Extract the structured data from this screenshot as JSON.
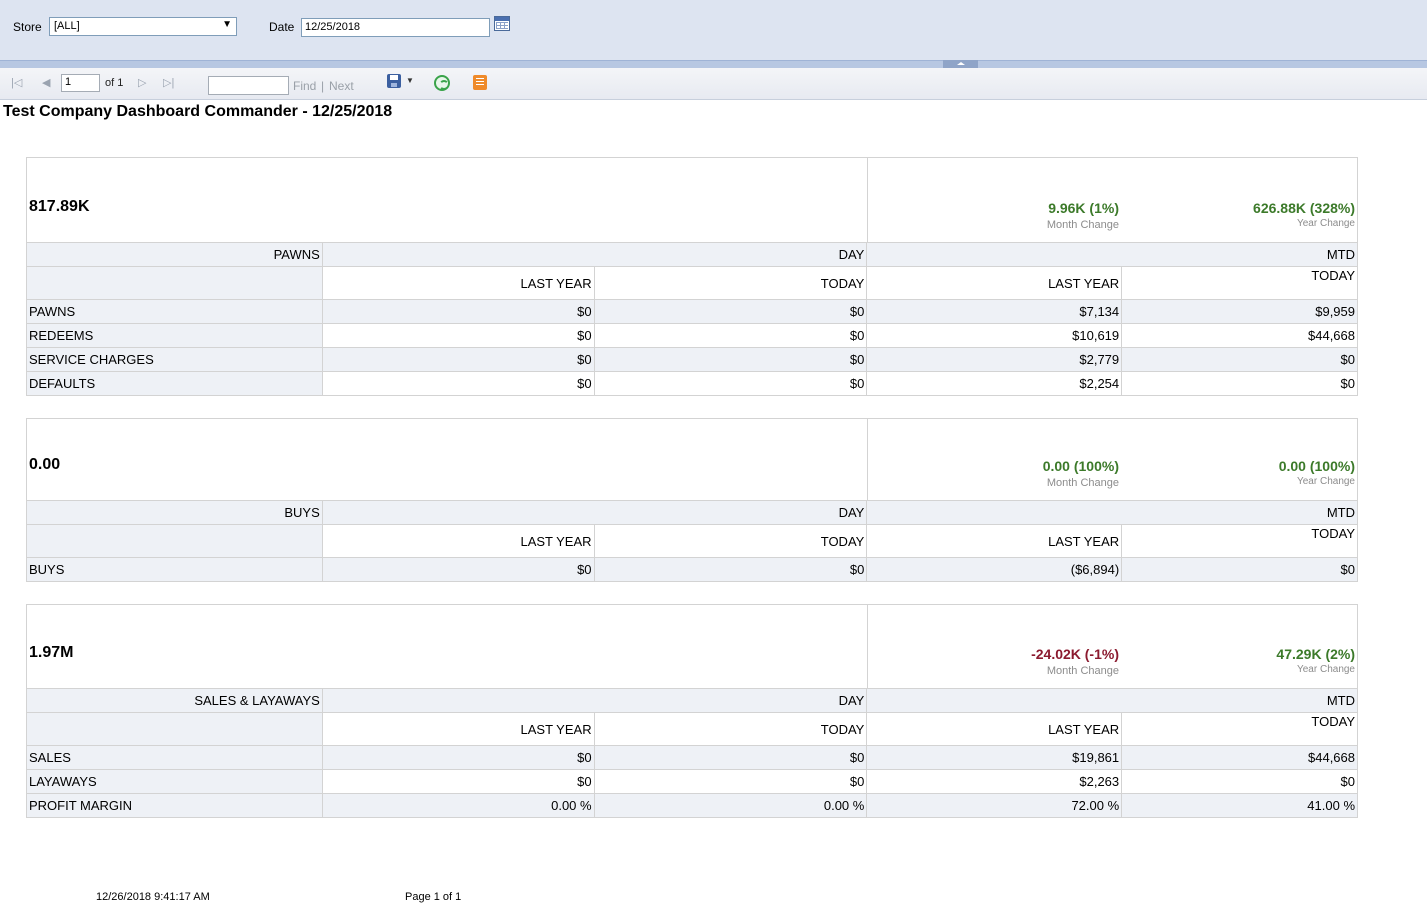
{
  "params": {
    "store_label": "Store",
    "store_value": "[ALL]",
    "date_label": "Date",
    "date_value": "12/25/2018"
  },
  "toolbar": {
    "page_value": "1",
    "of_label": "of 1",
    "find_label": "Find",
    "separator": "|",
    "next_label": "Next"
  },
  "report": {
    "title": "Test Company Dashboard Commander - 12/25/2018",
    "sections": [
      {
        "total": "817.89K",
        "month_change": "9.96K (1%)",
        "month_change_label": "Month Change",
        "year_change": "626.88K (328%)",
        "year_change_label": "Year Change",
        "category": "PAWNS",
        "day_label": "DAY",
        "mtd_label": "MTD",
        "col_last_year": "LAST YEAR",
        "col_today": "TODAY",
        "rows": [
          {
            "label": "PAWNS",
            "day_last_year": "$0",
            "day_today": "$0",
            "mtd_last_year": "$7,134",
            "mtd_today": "$9,959"
          },
          {
            "label": "REDEEMS",
            "day_last_year": "$0",
            "day_today": "$0",
            "mtd_last_year": "$10,619",
            "mtd_today": "$44,668"
          },
          {
            "label": "SERVICE CHARGES",
            "day_last_year": "$0",
            "day_today": "$0",
            "mtd_last_year": "$2,779",
            "mtd_today": "$0"
          },
          {
            "label": "DEFAULTS",
            "day_last_year": "$0",
            "day_today": "$0",
            "mtd_last_year": "$2,254",
            "mtd_today": "$0"
          }
        ]
      },
      {
        "total": "0.00",
        "month_change": "0.00 (100%)",
        "month_change_label": "Month Change",
        "year_change": "0.00 (100%)",
        "year_change_label": "Year Change",
        "category": "BUYS",
        "day_label": "DAY",
        "mtd_label": "MTD",
        "col_last_year": "LAST YEAR",
        "col_today": "TODAY",
        "rows": [
          {
            "label": "BUYS",
            "day_last_year": "$0",
            "day_today": "$0",
            "mtd_last_year": "($6,894)",
            "mtd_today": "$0"
          }
        ]
      },
      {
        "total": "1.97M",
        "month_change": "-24.02K (-1%)",
        "month_change_label": "Month Change",
        "year_change": "47.29K (2%)",
        "year_change_label": "Year Change",
        "category": "SALES & LAYAWAYS",
        "day_label": "DAY",
        "mtd_label": "MTD",
        "col_last_year": "LAST YEAR",
        "col_today": "TODAY",
        "rows": [
          {
            "label": "SALES",
            "day_last_year": "$0",
            "day_today": "$0",
            "mtd_last_year": "$19,861",
            "mtd_today": "$44,668"
          },
          {
            "label": "LAYAWAYS",
            "day_last_year": "$0",
            "day_today": "$0",
            "mtd_last_year": "$2,263",
            "mtd_today": "$0"
          },
          {
            "label": "PROFIT MARGIN",
            "day_last_year": "0.00 %",
            "day_today": "0.00 %",
            "mtd_last_year": "72.00 %",
            "mtd_today": "41.00 %"
          }
        ]
      }
    ],
    "footer_timestamp": "12/26/2018 9:41:17 AM",
    "footer_page": "Page 1 of 1"
  }
}
